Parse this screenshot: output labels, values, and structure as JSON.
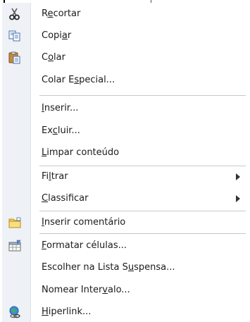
{
  "menu": {
    "items": [
      {
        "before": "R",
        "key": "e",
        "after": "cortar",
        "icon": "scissors-icon",
        "submenu": false
      },
      {
        "before": "Copi",
        "key": "a",
        "after": "r",
        "icon": "copy-icon",
        "submenu": false
      },
      {
        "before": "C",
        "key": "o",
        "after": "lar",
        "icon": "paste-icon",
        "submenu": false
      },
      {
        "before": "Colar E",
        "key": "s",
        "after": "pecial...",
        "icon": "",
        "submenu": false
      },
      {
        "before": "",
        "key": "I",
        "after": "nserir...",
        "icon": "",
        "submenu": false
      },
      {
        "before": "Ex",
        "key": "c",
        "after": "luir...",
        "icon": "",
        "submenu": false
      },
      {
        "before": "",
        "key": "L",
        "after": "impar conteúdo",
        "icon": "",
        "submenu": false
      },
      {
        "before": "Fi",
        "key": "l",
        "after": "trar",
        "icon": "",
        "submenu": true
      },
      {
        "before": "",
        "key": "C",
        "after": "lassificar",
        "icon": "",
        "submenu": true
      },
      {
        "before": "",
        "key": "I",
        "after": "nserir comentário",
        "icon": "comment-folder-icon",
        "submenu": false
      },
      {
        "before": "",
        "key": "F",
        "after": "ormatar células...",
        "icon": "format-cells-icon",
        "submenu": false
      },
      {
        "before": "Escolher na Lista S",
        "key": "u",
        "after": "spensa...",
        "icon": "",
        "submenu": false
      },
      {
        "before": "Nomear Inter",
        "key": "v",
        "after": "alo...",
        "icon": "",
        "submenu": false
      },
      {
        "before": "",
        "key": "H",
        "after": "iperlink...",
        "icon": "hyperlink-globe-icon",
        "submenu": false
      }
    ]
  },
  "colors": {
    "gutter": "#eef1f6",
    "separator": "#c6c8cc",
    "text": "#1b1b1b"
  }
}
